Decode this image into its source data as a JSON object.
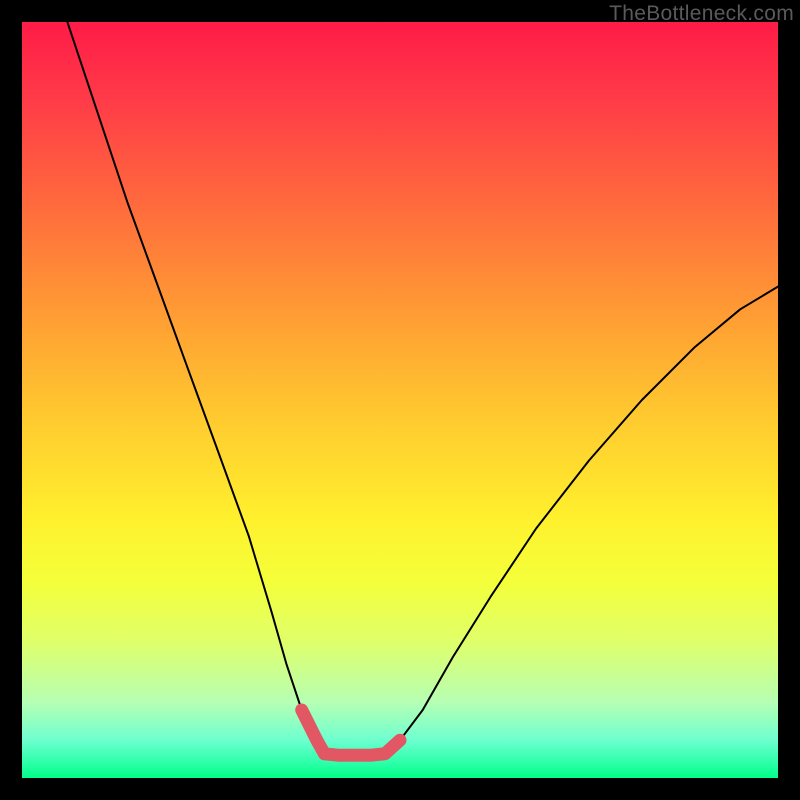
{
  "watermark": "TheBottleneck.com",
  "chart_data": {
    "type": "line",
    "title": "",
    "xlabel": "",
    "ylabel": "",
    "xlim": [
      0,
      100
    ],
    "ylim": [
      0,
      100
    ],
    "series": [
      {
        "name": "bottleneck-curve",
        "color": "#000000",
        "stroke_width": 2,
        "x": [
          6,
          10,
          14,
          18,
          22,
          26,
          30,
          33,
          35,
          37,
          39,
          40,
          42,
          44,
          46,
          48,
          50,
          53,
          57,
          62,
          68,
          75,
          82,
          89,
          95,
          100
        ],
        "y": [
          100,
          88,
          76,
          65,
          54,
          43,
          32,
          22,
          15,
          9,
          5,
          3.2,
          3.0,
          3.0,
          3.0,
          3.2,
          5,
          9,
          16,
          24,
          33,
          42,
          50,
          57,
          62,
          65
        ]
      },
      {
        "name": "optimal-zone",
        "color": "#e15864",
        "stroke_width": 13,
        "x": [
          37,
          39,
          40,
          42,
          44,
          46,
          48,
          50
        ],
        "y": [
          9,
          5,
          3.2,
          3.0,
          3.0,
          3.0,
          3.2,
          5
        ]
      }
    ],
    "background_gradient": {
      "top": "#ff1b47",
      "bottom": "#00ff87"
    }
  }
}
